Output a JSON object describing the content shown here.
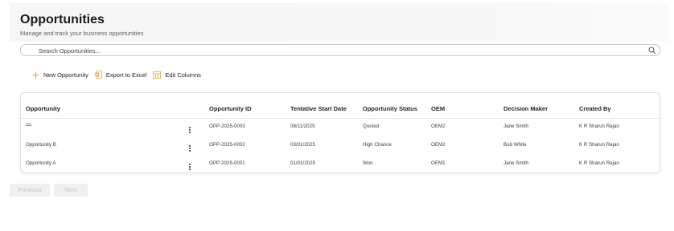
{
  "page": {
    "title": "Opportunities",
    "subtitle": "Manage and track your business opportunities"
  },
  "search": {
    "placeholder": "Search Opportunities..."
  },
  "toolbar": {
    "new_label": "New Opportunity",
    "export_label": "Export to Excel",
    "columns_label": "Edit Columns"
  },
  "colors": {
    "accent_plus": "#e8a33d",
    "excel_icon": "#e8a33d",
    "columns_icon": "#e8a33d"
  },
  "table": {
    "columns": [
      "Opportunity",
      "Opportunity ID",
      "Tentative Start Date",
      "Opportunity Status",
      "OEM",
      "Decision Maker",
      "Created By"
    ],
    "rows": [
      {
        "name": "",
        "id": "OPP-2025-0003",
        "start": "08/11/2025",
        "status": "Quoted",
        "oem": "OEM2",
        "maker": "Jane Smith",
        "created": "K R Sharun Rajan"
      },
      {
        "name": "Opportunity B",
        "id": "OPP-2025-0002",
        "start": "03/01/2025",
        "status": "High Chance",
        "oem": "OEM2",
        "maker": "Bob White",
        "created": "K R Sharun Rajan"
      },
      {
        "name": "Opportunity A",
        "id": "OPP-2025-0001",
        "start": "01/01/2025",
        "status": "Won",
        "oem": "OEM1",
        "maker": "Jane Smith",
        "created": "K R Sharun Rajan"
      }
    ]
  },
  "pager": {
    "previous": "Previous",
    "next": "Next"
  }
}
